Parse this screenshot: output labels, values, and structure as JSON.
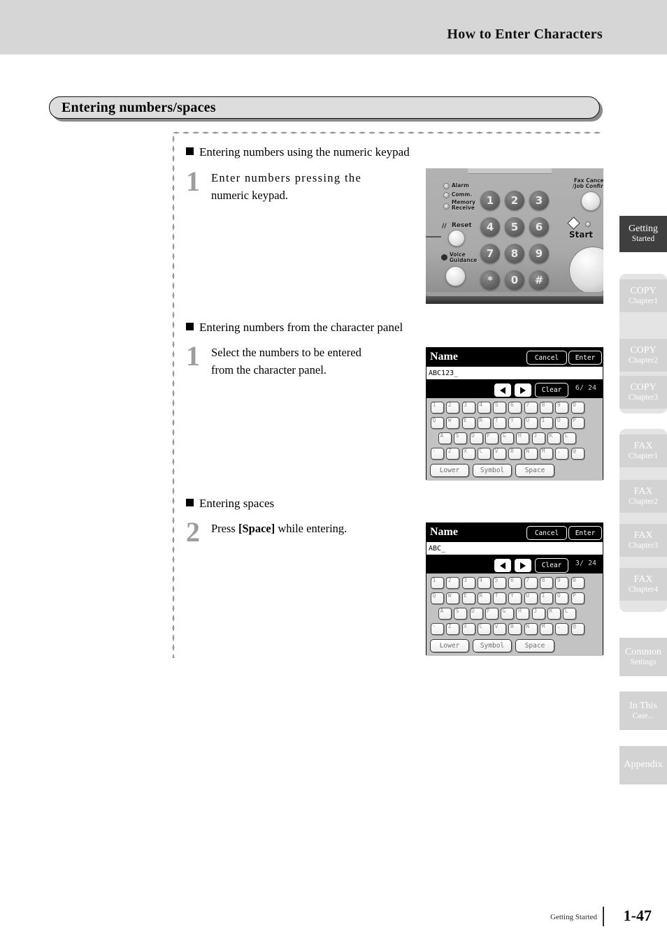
{
  "header": {
    "title": "How to Enter Characters"
  },
  "section": {
    "title": "Entering numbers/spaces"
  },
  "sections": [
    {
      "heading": "Entering numbers using the numeric keypad",
      "step_number": "1",
      "step_line1": "Enter numbers pressing the",
      "step_line2": "numeric keypad."
    },
    {
      "heading": "Entering numbers from the character panel",
      "step_number": "1",
      "step_line1": "Select the numbers to be entered",
      "step_line2": "from the character panel."
    },
    {
      "heading": "Entering spaces",
      "step_number": "2",
      "step_line1_a": "Press ",
      "step_line1_b": "[Space]",
      "step_line1_c": " while entering."
    }
  ],
  "keypad_photo": {
    "leds": [
      "Alarm",
      "Comm.",
      "Memory\nReceive"
    ],
    "led_labels": {
      "alarm": "Alarm",
      "comm": "Comm.",
      "memory_receive_1": "Memory",
      "memory_receive_2": "Receive"
    },
    "reset_label": "Reset",
    "reset_slash": "//",
    "voice_guidance_1": "Voice",
    "voice_guidance_2": "Guidance",
    "fax_cancel_1": "Fax Cancel",
    "fax_cancel_2": "/Job Confirm",
    "start_label": "Start",
    "keys": [
      "1",
      "2",
      "3",
      "4",
      "5",
      "6",
      "7",
      "8",
      "9",
      "*",
      "0",
      "#"
    ]
  },
  "lcd_panels": [
    {
      "title": "Name",
      "cancel_label": "Cancel",
      "enter_label": "Enter",
      "input_value": "ABC123_",
      "clear_label": "Clear",
      "counter": "6/ 24",
      "left_arrow": "left-arrow",
      "right_arrow": "right-arrow",
      "rows": [
        [
          "1",
          "2",
          "3",
          "4",
          "5",
          "6",
          "7",
          "8",
          "9",
          "0"
        ],
        [
          "Q",
          "W",
          "E",
          "R",
          "T",
          "Y",
          "U",
          "I",
          "O",
          "P"
        ],
        [
          "A",
          "S",
          "D",
          "F",
          "G",
          "H",
          "J",
          "K",
          "L"
        ],
        [
          "-",
          "Z",
          "X",
          "C",
          "V",
          "B",
          "N",
          "M",
          ".",
          "@"
        ]
      ],
      "bottom_buttons": [
        "Lower",
        "Symbol",
        "Space"
      ]
    },
    {
      "title": "Name",
      "cancel_label": "Cancel",
      "enter_label": "Enter",
      "input_value": "ABC_",
      "clear_label": "Clear",
      "counter": "3/ 24",
      "left_arrow": "left-arrow",
      "right_arrow": "right-arrow",
      "rows": [
        [
          "1",
          "2",
          "3",
          "4",
          "5",
          "6",
          "7",
          "8",
          "9",
          "0"
        ],
        [
          "Q",
          "W",
          "E",
          "R",
          "T",
          "Y",
          "U",
          "I",
          "O",
          "P"
        ],
        [
          "A",
          "S",
          "D",
          "F",
          "G",
          "H",
          "J",
          "K",
          "L"
        ],
        [
          "-",
          "Z",
          "X",
          "C",
          "V",
          "B",
          "N",
          "M",
          ".",
          "@"
        ]
      ],
      "bottom_buttons": [
        "Lower",
        "Symbol",
        "Space"
      ]
    }
  ],
  "side_tabs": [
    {
      "line1": "Getting",
      "line2": "Started",
      "active": true
    },
    {
      "line1": "COPY",
      "line2": "Chapter1",
      "active": false
    },
    {
      "line1": "COPY",
      "line2": "Chapter2",
      "active": false
    },
    {
      "line1": "COPY",
      "line2": "Chapter3",
      "active": false
    },
    {
      "line1": "FAX",
      "line2": "Chapter1",
      "active": false
    },
    {
      "line1": "FAX",
      "line2": "Chapter2",
      "active": false
    },
    {
      "line1": "FAX",
      "line2": "Chapter3",
      "active": false
    },
    {
      "line1": "FAX",
      "line2": "Chapter4",
      "active": false
    },
    {
      "line1": "Common",
      "line2": "Settings",
      "active": false
    },
    {
      "line1": "In This",
      "line2": "Case...",
      "active": false
    },
    {
      "line1": "Appendix",
      "line2": "",
      "active": false
    }
  ],
  "footer": {
    "label": "Getting Started",
    "page": "1-47"
  },
  "colors": {
    "header_band": "#d6d6d6",
    "section_bar": "#dddddd",
    "active_tab": "#3f3f3f",
    "tab_gray": "#d3d3d3",
    "step_number": "#9d9d9d"
  }
}
